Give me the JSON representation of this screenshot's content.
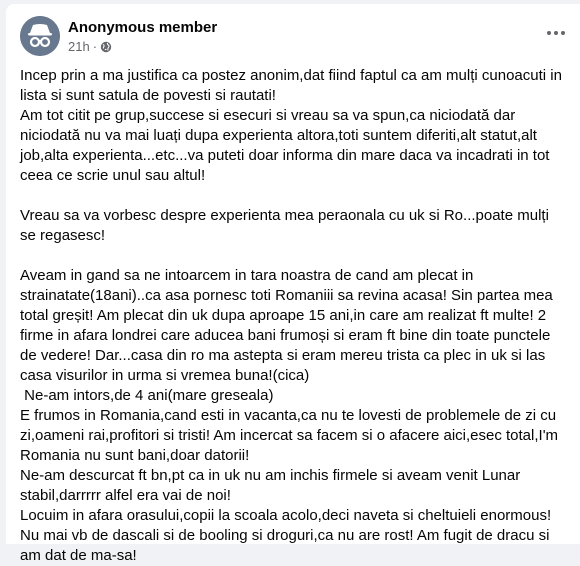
{
  "post": {
    "author": "Anonymous member",
    "time": "21h",
    "separator": "·",
    "privacy_icon": "globe-icon",
    "more_icon": "more-options-icon",
    "paragraphs": [
      "Incep prin a ma justifica ca postez anonim,dat fiind faptul ca am mulți cunoacuti in lista si sunt satula de povesti si rautati!\nAm tot citit pe grup,succese si esecuri si vreau sa va spun,ca niciodată dar niciodată nu va mai luați dupa experienta altora,toti suntem diferiti,alt statut,alt job,alta experienta...etc...va puteti doar informa din mare daca va incadrati in tot ceea ce scrie unul sau altul!",
      "Vreau sa va vorbesc despre experienta mea peraonala cu uk si Ro...poate mulți se regasesc!",
      "Aveam in gand sa ne intoarcem in tara noastra de cand am plecat in strainatate(18ani)..ca asa pornesc toti Romaniii sa revina acasa! Sin partea mea total greșit! Am plecat din uk dupa aproape 15 ani,in care am realizat ft multe! 2 firme in afara londrei care aducea bani frumoși si eram ft bine din toate punctele de vedere! Dar...casa din ro ma astepta si eram mereu trista ca plec in uk si las casa visurilor in urma si vremea buna!(cica)\n Ne-am intors,de 4 ani(mare greseala)\nE frumos in Romania,cand esti in vacanta,ca nu te lovesti de problemele de zi cu zi,oameni rai,profitori si tristi! Am incercat sa facem si o afacere aici,esec total,I'm Romania nu sunt bani,doar datorii!\nNe-am descurcat ft bn,pt ca in uk nu am inchis firmele si aveam venit Lunar stabil,darrrrr alfel era vai de noi!\nLocuim in afara orasului,copii la scoala acolo,deci naveta si cheltuieli enormous! Nu mai vb de dascali si de booling si droguri,ca nu are rost! Am fugit de dracu si am dat de ma-sa!"
    ]
  }
}
